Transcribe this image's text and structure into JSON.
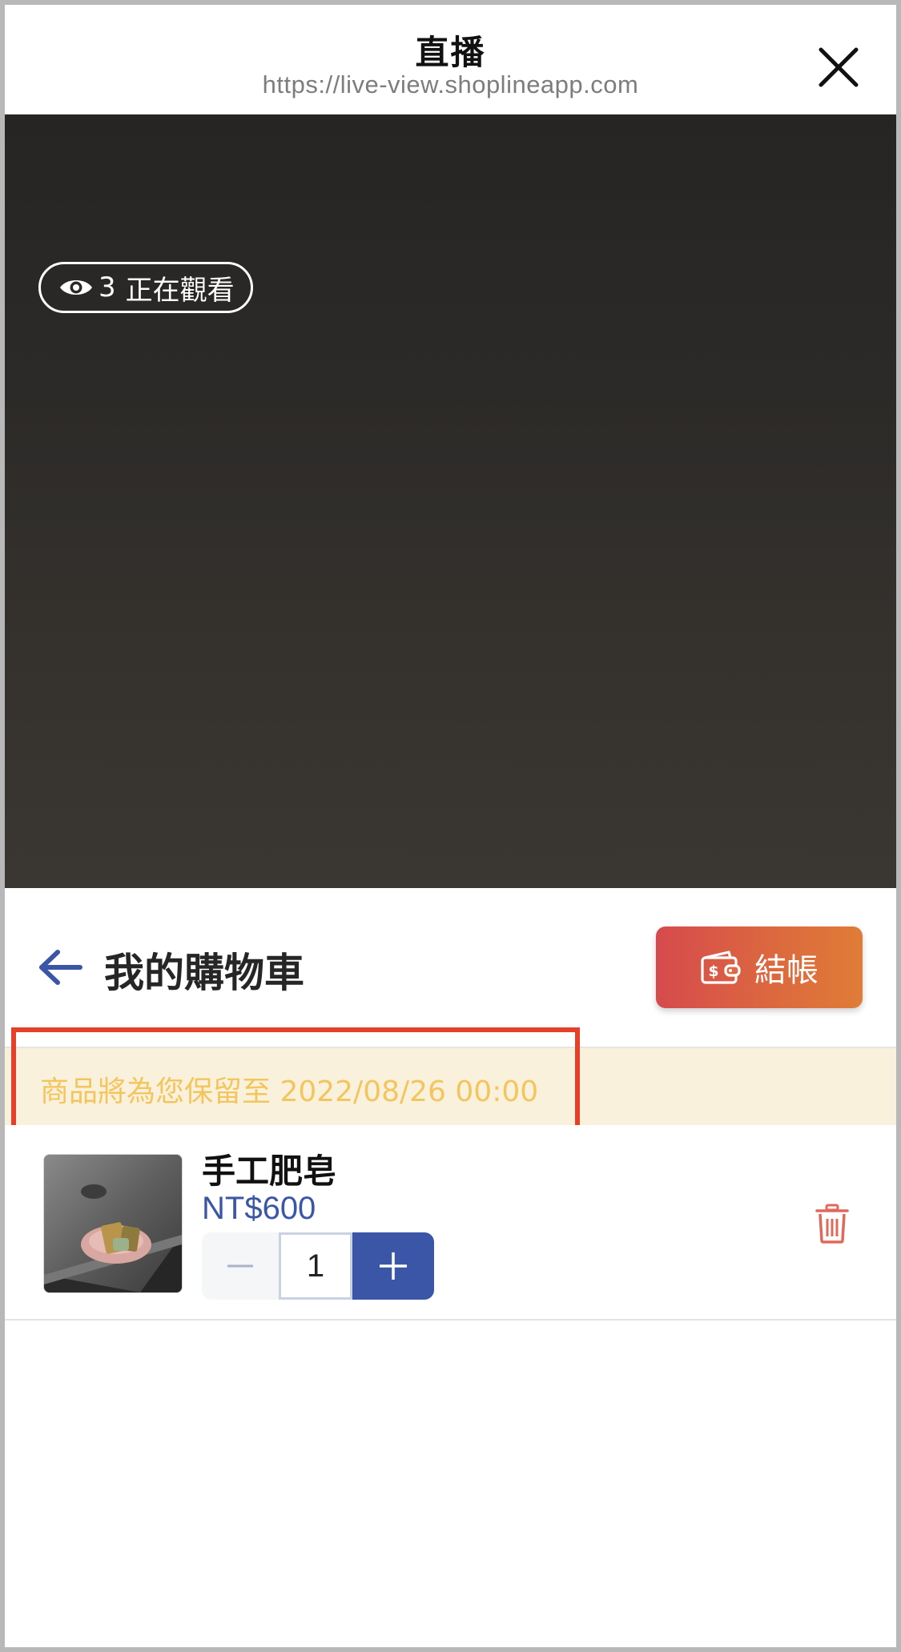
{
  "header": {
    "title": "直播",
    "url": "https://live-view.shoplineapp.com"
  },
  "video": {
    "viewer_count": "3",
    "viewer_label": "正在觀看"
  },
  "cart": {
    "title": "我的購物車",
    "checkout_label": "結帳",
    "reservation_notice": "商品將為您保留至 2022/08/26 00:00",
    "items": [
      {
        "name": "手工肥皂",
        "price": "NT$600",
        "quantity": "1"
      }
    ]
  },
  "colors": {
    "accent_blue": "#3b56a7",
    "checkout_gradient_start": "#d64a4d",
    "checkout_gradient_end": "#e07c37",
    "notice_bg": "#faf1dd",
    "notice_text": "#f3c55d",
    "highlight_border": "#e4402a",
    "trash": "#e06a5a"
  },
  "icons": {
    "close": "close-icon",
    "viewers": "eye-icon",
    "back": "arrow-left-icon",
    "checkout": "wallet-icon",
    "delete": "trash-icon",
    "decrement": "minus-icon",
    "increment": "plus-icon"
  }
}
